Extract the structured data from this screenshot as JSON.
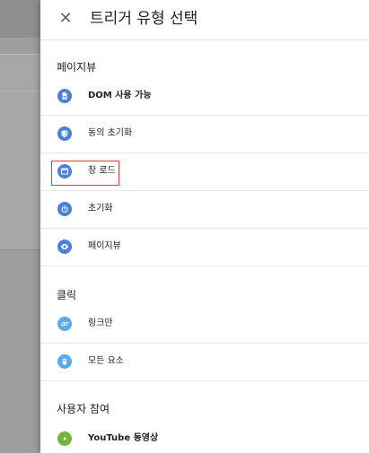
{
  "header": {
    "title": "트리거 유형 선택",
    "close_glyph": "✕"
  },
  "sections": {
    "pageview": {
      "label": "페이지뷰"
    },
    "click": {
      "label": "클릭"
    },
    "engagement": {
      "label": "사용자 참여"
    }
  },
  "items": {
    "dom_ready": {
      "label": "DOM 사용 가능",
      "icon": "document-icon",
      "color": "#4a7fdc"
    },
    "consent_init": {
      "label": "동의 초기화",
      "icon": "shield-icon",
      "color": "#4a7fdc"
    },
    "window_loaded": {
      "label": "창 로드",
      "icon": "window-icon",
      "color": "#4a7fdc"
    },
    "initialization": {
      "label": "초기화",
      "icon": "power-icon",
      "color": "#4a7fdc"
    },
    "page_view": {
      "label": "페이지뷰",
      "icon": "eye-icon",
      "color": "#4a7fdc"
    },
    "just_links": {
      "label": "링크만",
      "icon": "link-icon",
      "color": "#5aaaf0"
    },
    "all_elements": {
      "label": "모든 요소",
      "icon": "mouse-icon",
      "color": "#5aaaf0"
    },
    "youtube_video": {
      "label": "YouTube 동영상",
      "icon": "play-icon",
      "color": "#6fb63c"
    }
  },
  "colors": {
    "highlight": "#d9433a",
    "accent_blue": "#4a7fdc"
  }
}
